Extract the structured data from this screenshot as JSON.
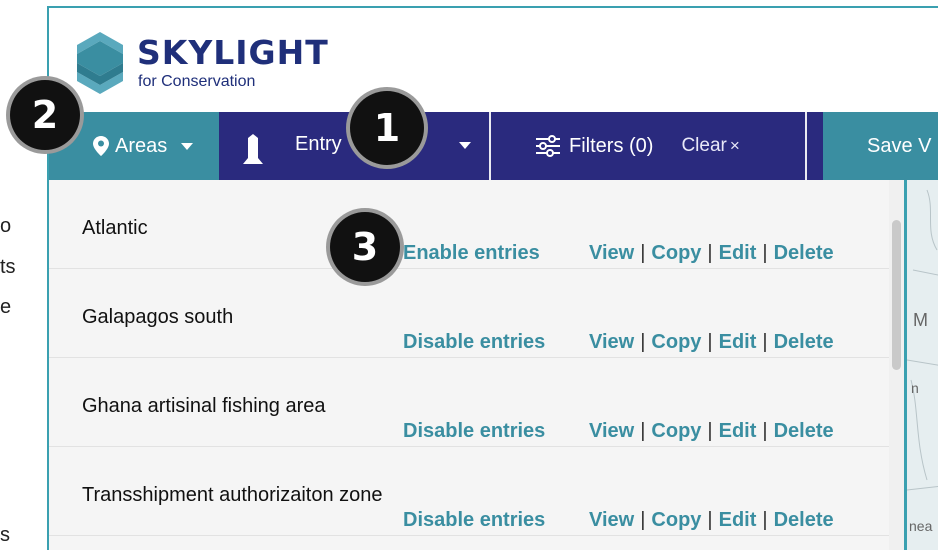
{
  "background_fragments": [
    "o",
    "ts",
    "e",
    "s"
  ],
  "brand": {
    "name": "SKYLIGHT",
    "subtitle": "for Conservation"
  },
  "toolbar": {
    "areas_label": "Areas",
    "entry_label": "Entry",
    "filters_label": "Filters (0)",
    "clear_label": "Clear",
    "clear_x": "×",
    "save_label": "Save V"
  },
  "areas": [
    {
      "name": "Atlantic",
      "toggle": "Enable entries"
    },
    {
      "name": "Galapagos south",
      "toggle": "Disable entries"
    },
    {
      "name": "Ghana artisinal fishing area",
      "toggle": "Disable entries"
    },
    {
      "name": "Transshipment authorizaiton zone",
      "toggle": "Disable entries"
    }
  ],
  "row_actions": {
    "view": "View",
    "copy": "Copy",
    "edit": "Edit",
    "delete": "Delete",
    "separator": "|"
  },
  "map_fragments": [
    "M",
    "n",
    "nea"
  ],
  "badges": {
    "one": "1",
    "two": "2",
    "three": "3"
  },
  "colors": {
    "navy": "#2a2a7e",
    "teal": "#3a8ea1",
    "brand": "#1f2f7a",
    "link": "#3a8ea1"
  },
  "icons": {
    "areas": "map-pin-icon",
    "entry": "entry-icon",
    "filters": "sliders-icon",
    "dropdown": "caret-down-icon",
    "logo": "skylight-logo"
  }
}
